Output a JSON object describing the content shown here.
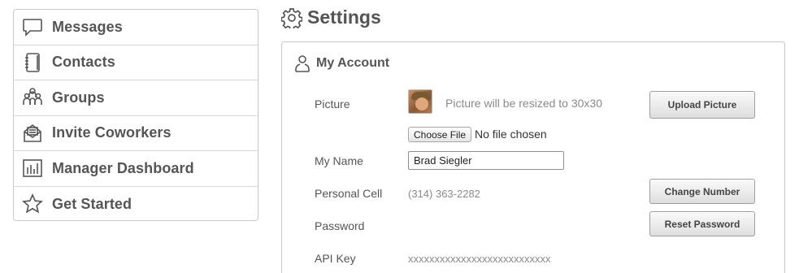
{
  "sidebar": {
    "items": [
      {
        "label": "Messages",
        "icon": "speech-bubble-icon"
      },
      {
        "label": "Contacts",
        "icon": "address-book-icon"
      },
      {
        "label": "Groups",
        "icon": "people-icon"
      },
      {
        "label": "Invite Coworkers",
        "icon": "envelope-icon"
      },
      {
        "label": "Manager Dashboard",
        "icon": "bar-chart-icon"
      },
      {
        "label": "Get Started",
        "icon": "star-icon"
      }
    ]
  },
  "page": {
    "title": "Settings",
    "icon": "gear-icon"
  },
  "account": {
    "title": "My Account",
    "icon": "person-icon",
    "picture_label": "Picture",
    "picture_hint": "Picture will be resized to 30x30",
    "choose_file_label": "Choose File",
    "file_status": "No file chosen",
    "upload_button": "Upload Picture",
    "name_label": "My Name",
    "name_value": "Brad Siegler",
    "cell_label": "Personal Cell",
    "cell_value": "(314) 363-2282",
    "change_number_button": "Change Number",
    "password_label": "Password",
    "reset_password_button": "Reset Password",
    "api_key_label": "API Key",
    "api_key_value": "xxxxxxxxxxxxxxxxxxxxxxxxxxx"
  }
}
